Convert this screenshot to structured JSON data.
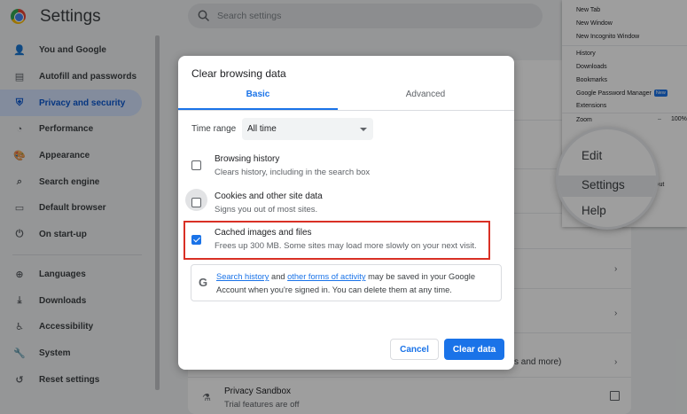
{
  "app": {
    "title": "Settings"
  },
  "search": {
    "placeholder": "Search settings"
  },
  "sidebar": {
    "items": [
      {
        "label": "You and Google",
        "icon": "person-icon"
      },
      {
        "label": "Autofill and passwords",
        "icon": "clipboard-icon"
      },
      {
        "label": "Privacy and security",
        "icon": "shield-icon",
        "active": true
      },
      {
        "label": "Performance",
        "icon": "speedometer-icon"
      },
      {
        "label": "Appearance",
        "icon": "palette-icon"
      },
      {
        "label": "Search engine",
        "icon": "search-icon"
      },
      {
        "label": "Default browser",
        "icon": "browser-icon"
      },
      {
        "label": "On start-up",
        "icon": "power-icon"
      },
      {
        "label": "Languages",
        "icon": "globe-icon"
      },
      {
        "label": "Downloads",
        "icon": "download-icon"
      },
      {
        "label": "Accessibility",
        "icon": "accessibility-icon"
      },
      {
        "label": "System",
        "icon": "wrench-icon"
      },
      {
        "label": "Reset settings",
        "icon": "reset-icon"
      }
    ]
  },
  "background": {
    "partial_text": "s and more)",
    "privacy_sandbox": {
      "title": "Privacy Sandbox",
      "subtitle": "Trial features are off"
    }
  },
  "dialog": {
    "title": "Clear browsing data",
    "tabs": [
      {
        "label": "Basic",
        "active": true
      },
      {
        "label": "Advanced",
        "active": false
      }
    ],
    "time_range": {
      "label": "Time range",
      "value": "All time"
    },
    "options": [
      {
        "title": "Browsing history",
        "subtitle": "Clears history, including in the search box",
        "checked": false
      },
      {
        "title": "Cookies and other site data",
        "subtitle": "Signs you out of most sites.",
        "checked": false
      },
      {
        "title": "Cached images and files",
        "subtitle": "Frees up 300 MB. Some sites may load more slowly on your next visit.",
        "checked": true
      }
    ],
    "info": {
      "link1": "Search history",
      "text1": " and ",
      "link2": "other forms of activity",
      "text2": " may be saved in your Google Account when you're signed in. You can delete them at any time."
    },
    "buttons": {
      "cancel": "Cancel",
      "clear": "Clear data"
    }
  },
  "chrome_menu": {
    "items": [
      "New Tab",
      "New Window",
      "New Incognito Window",
      "History",
      "Downloads",
      "Bookmarks",
      "Google Password Manager",
      "Extensions",
      "Zoom"
    ],
    "new_badge": "New",
    "zoom_minus": "–",
    "zoom_value": "100%",
    "strip_text": "Out",
    "magnified": [
      "Edit",
      "Settings",
      "Help"
    ]
  },
  "colors": {
    "accent": "#1a73e8",
    "highlight_border": "#d93025",
    "active_nav_bg": "#d3e3fd"
  }
}
